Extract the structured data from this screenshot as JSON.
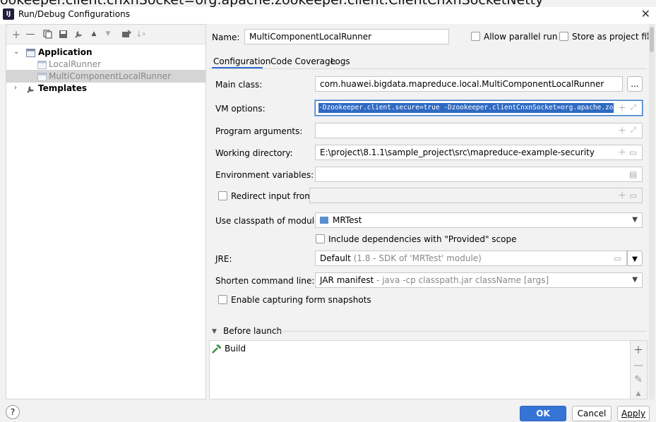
{
  "clipped_top_text": "ookeeper.client.cnxnSocket=org.apache.zookeeper.client.ClientCnxnSocketNetty",
  "window": {
    "title": "Run/Debug Configurations",
    "app_icon": "IJ"
  },
  "left": {
    "tree": [
      {
        "label": "Application",
        "kind": "group"
      },
      {
        "label": "LocalRunner",
        "kind": "item"
      },
      {
        "label": "MultiComponentLocalRunner",
        "kind": "item",
        "selected": true
      },
      {
        "label": "Templates",
        "kind": "group"
      }
    ]
  },
  "header": {
    "name_label": "Name:",
    "name_value": "MultiComponentLocalRunner",
    "allow_parallel_label": "Allow parallel run",
    "store_as_project_label": "Store as project file"
  },
  "tabs": [
    "Configuration",
    "Code Coverage",
    "Logs"
  ],
  "form": {
    "main_class_label": "Main class:",
    "main_class_value": "com.huawei.bigdata.mapreduce.local.MultiComponentLocalRunner",
    "main_class_browse": "...",
    "vm_options_label": "VM options:",
    "vm_options_value": "-Dzookeeper.client.secure=true -Dzookeeper.clientCnxnSocket=org.apache.zookeeper",
    "program_args_label": "Program arguments:",
    "program_args_value": "",
    "working_dir_label": "Working directory:",
    "working_dir_value": "E:\\project\\8.1.1\\sample_project\\src\\mapreduce-example-security",
    "env_vars_label": "Environment variables:",
    "env_vars_value": "",
    "redirect_input_label": "Redirect input from:",
    "redirect_input_value": "",
    "classpath_module_label": "Use classpath of module:",
    "classpath_module_value": "MRTest",
    "include_provided_label": "Include dependencies with \"Provided\" scope",
    "jre_label": "JRE:",
    "jre_value_main": "Default",
    "jre_value_detail": "(1.8 - SDK of 'MRTest' module)",
    "shorten_cmd_label": "Shorten command line:",
    "shorten_cmd_value_main": "JAR manifest",
    "shorten_cmd_value_detail": "- java -cp classpath.jar className [args]",
    "capture_snapshots_label": "Enable capturing form snapshots"
  },
  "before_launch": {
    "title": "Before launch",
    "tasks": [
      "Build"
    ]
  },
  "buttons": {
    "help": "?",
    "ok": "OK",
    "cancel": "Cancel",
    "apply": "Apply"
  },
  "colors": {
    "accent": "#3574d4",
    "selection": "#d5d5d5",
    "vm_highlight": "#2f6ac2"
  }
}
